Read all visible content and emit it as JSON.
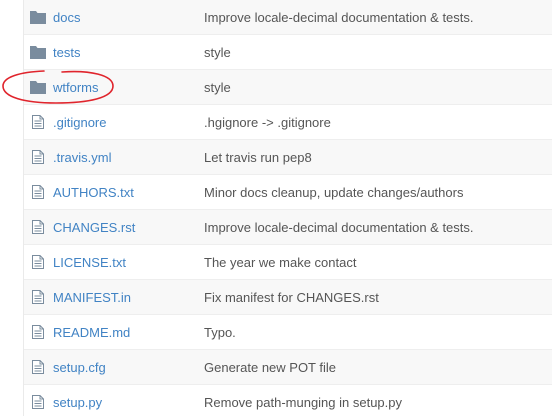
{
  "files": [
    {
      "type": "folder",
      "icon": "folder-icon",
      "name": "docs",
      "message": "Improve locale-decimal documentation & tests."
    },
    {
      "type": "folder",
      "icon": "folder-icon",
      "name": "tests",
      "message": "style"
    },
    {
      "type": "folder",
      "icon": "folder-icon",
      "name": "wtforms",
      "message": "style"
    },
    {
      "type": "file",
      "icon": "file-text-icon",
      "name": ".gitignore",
      "message": ".hgignore -> .gitignore"
    },
    {
      "type": "file",
      "icon": "file-text-icon",
      "name": ".travis.yml",
      "message": "Let travis run pep8"
    },
    {
      "type": "file",
      "icon": "file-text-icon",
      "name": "AUTHORS.txt",
      "message": "Minor docs cleanup, update changes/authors"
    },
    {
      "type": "file",
      "icon": "file-text-icon",
      "name": "CHANGES.rst",
      "message": "Improve locale-decimal documentation & tests."
    },
    {
      "type": "file",
      "icon": "file-text-icon",
      "name": "LICENSE.txt",
      "message": "The year we make contact"
    },
    {
      "type": "file",
      "icon": "file-text-icon",
      "name": "MANIFEST.in",
      "message": "Fix manifest for CHANGES.rst"
    },
    {
      "type": "file",
      "icon": "file-text-icon",
      "name": "README.md",
      "message": "Typo."
    },
    {
      "type": "file",
      "icon": "file-text-icon",
      "name": "setup.cfg",
      "message": "Generate new POT file"
    },
    {
      "type": "file",
      "icon": "file-text-icon",
      "name": "setup.py",
      "message": "Remove path-munging in setup.py"
    }
  ],
  "highlight": {
    "target": "wtforms",
    "color": "#e0242c"
  },
  "colors": {
    "link": "#4183c4",
    "icon": "#7a8c9e",
    "message": "#555555",
    "row_alt": "#f8f8f8"
  }
}
